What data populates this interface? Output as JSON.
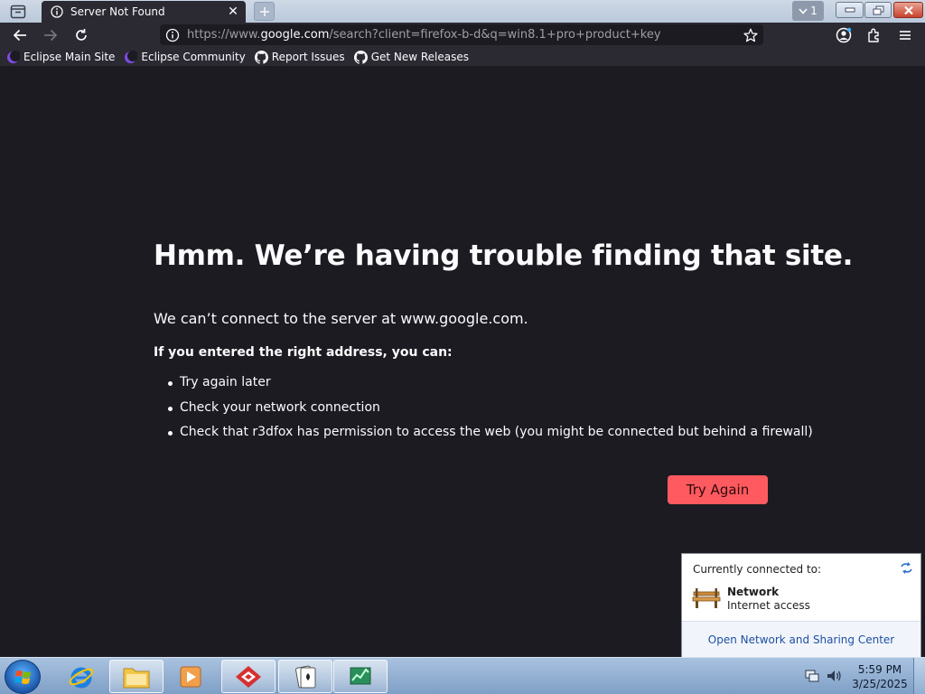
{
  "browser": {
    "tab": {
      "title": "Server Not Found"
    },
    "all_tabs_count": "1",
    "url": {
      "prefix": "https://www.",
      "host": "google.com",
      "rest": "/search?client=firefox-b-d&q=win8.1+pro+product+key"
    },
    "bookmarks": [
      {
        "label": "Eclipse Main Site",
        "icon": "eclipse-icon"
      },
      {
        "label": "Eclipse Community",
        "icon": "eclipse-icon"
      },
      {
        "label": "Report Issues",
        "icon": "github-icon"
      },
      {
        "label": "Get New Releases",
        "icon": "github-icon"
      }
    ]
  },
  "error_page": {
    "title": "Hmm. We’re having trouble finding that site.",
    "description": "We can’t connect to the server at www.google.com.",
    "subtitle": "If you entered the right address, you can:",
    "suggestions": [
      "Try again later",
      "Check your network connection",
      "Check that r3dfox has permission to access the web (you might be connected but behind a firewall)"
    ],
    "button": "Try Again"
  },
  "network_flyout": {
    "heading": "Currently connected to:",
    "network_name": "Network",
    "network_status": "Internet access",
    "link": "Open Network and Sharing Center"
  },
  "taskbar": {
    "time": "5:59 PM",
    "date": "3/25/2025"
  },
  "colors": {
    "page_bg": "#1c1b22",
    "toolbar_bg": "#2b2a33",
    "accent_button": "#ff5a5f",
    "link": "#1f4fa3"
  }
}
